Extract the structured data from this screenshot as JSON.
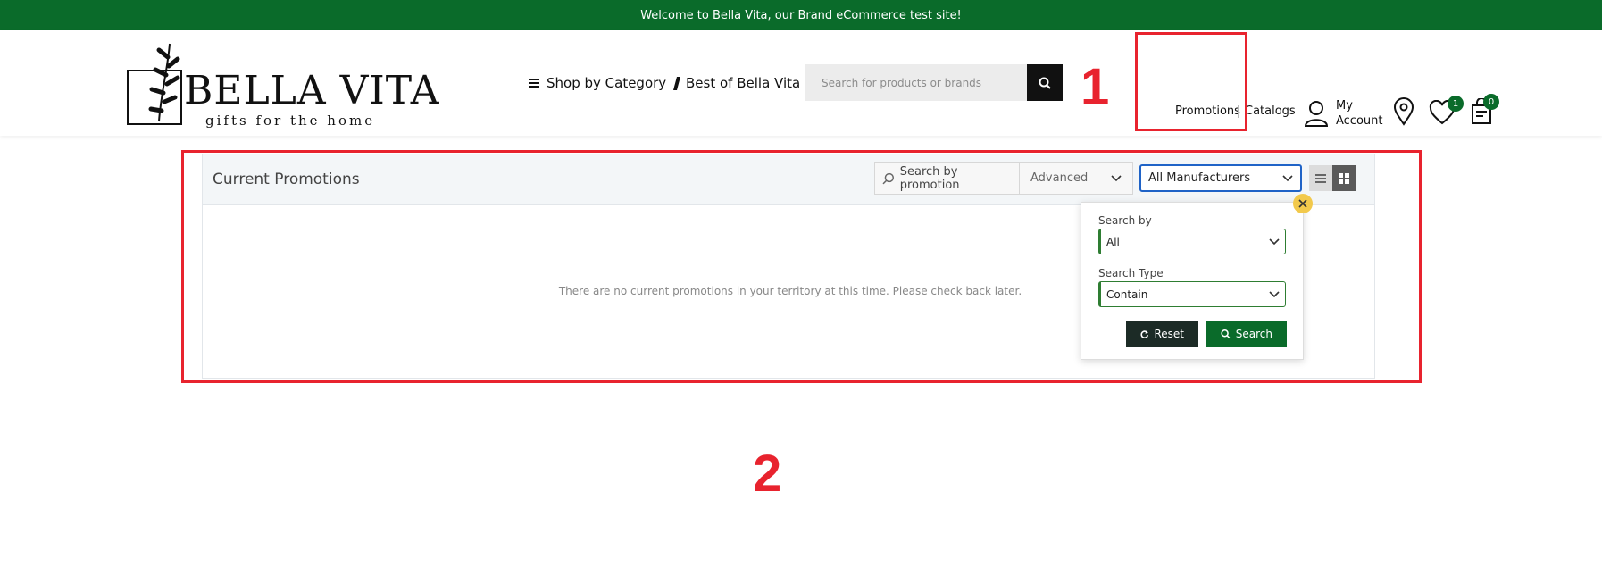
{
  "topbar": {
    "message": "Welcome to Bella Vita, our Brand eCommerce test site!"
  },
  "logo": {
    "name": "BELLA VITA",
    "tagline": "gifts for the home"
  },
  "nav": {
    "shop_by_category": "Shop by Category",
    "best_of": "Best of Bella Vita"
  },
  "search": {
    "placeholder": "Search for products or brands"
  },
  "header_links": {
    "promotions": "Promotions",
    "catalogs": "Catalogs",
    "account_line1": "My",
    "account_line2": "Account"
  },
  "badges": {
    "wishlist_count": "1",
    "cart_count": "0"
  },
  "annotations": {
    "one": "1",
    "two": "2"
  },
  "panel": {
    "title": "Current Promotions",
    "search_label": "Search by promotion",
    "advanced_label": "Advanced",
    "manufacturer_selected": "All Manufacturers",
    "empty_message": "There are no current promotions in your territory at this time. Please check back later."
  },
  "advanced_popup": {
    "search_by_label": "Search by",
    "search_by_value": "All",
    "search_type_label": "Search Type",
    "search_type_value": "Contain",
    "reset_label": "Reset",
    "search_label": "Search"
  },
  "colors": {
    "brand_green": "#0a6b2a",
    "annotation_red": "#e8232e",
    "select_blue": "#1f63c7"
  },
  "icons": [
    "menu-icon",
    "search-icon",
    "user-icon",
    "map-pin-icon",
    "heart-icon",
    "shopping-bag-icon",
    "chevron-down-icon",
    "list-view-icon",
    "grid-view-icon",
    "close-icon",
    "refresh-icon"
  ]
}
